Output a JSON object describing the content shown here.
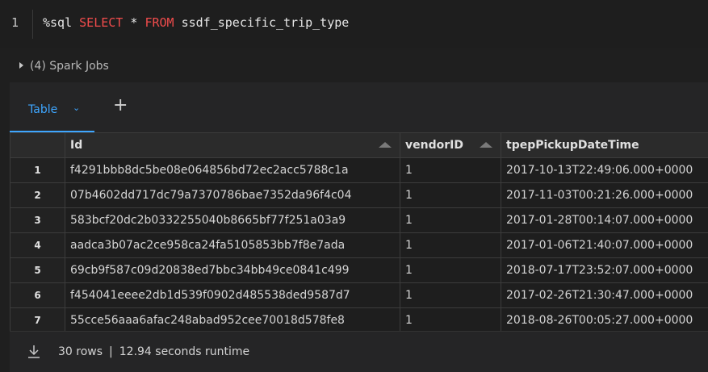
{
  "code": {
    "line_number": "1",
    "magic": "%sql",
    "keyword_select": "SELECT",
    "star": "*",
    "keyword_from": "FROM",
    "table_name": "ssdf_specific_trip_type"
  },
  "spark_jobs": {
    "label": "(4) Spark Jobs"
  },
  "tabs": {
    "active_label": "Table",
    "add_label": "+"
  },
  "table": {
    "columns": [
      "Id",
      "vendorID",
      "tpepPickupDateTime"
    ],
    "rows": [
      {
        "n": "1",
        "id": "f4291bbb8dc5be08e064856bd72ec2acc5788c1a",
        "vendor": "1",
        "pickup": "2017-10-13T22:49:06.000+0000"
      },
      {
        "n": "2",
        "id": "07b4602dd717dc79a7370786bae7352da96f4c04",
        "vendor": "1",
        "pickup": "2017-11-03T00:21:26.000+0000"
      },
      {
        "n": "3",
        "id": "583bcf20dc2b0332255040b8665bf77f251a03a9",
        "vendor": "1",
        "pickup": "2017-01-28T00:14:07.000+0000"
      },
      {
        "n": "4",
        "id": "aadca3b07ac2ce958ca24fa5105853bb7f8e7ada",
        "vendor": "1",
        "pickup": "2017-01-06T21:40:07.000+0000"
      },
      {
        "n": "5",
        "id": "69cb9f587c09d20838ed7bbc34bb49ce0841c499",
        "vendor": "1",
        "pickup": "2018-07-17T23:52:07.000+0000"
      },
      {
        "n": "6",
        "id": "f454041eeee2db1d539f0902d485538ded9587d7",
        "vendor": "1",
        "pickup": "2017-02-26T21:30:47.000+0000"
      },
      {
        "n": "7",
        "id": "55cce56aaa6afac248abad952cee70018d578fe8",
        "vendor": "1",
        "pickup": "2018-08-26T00:05:27.000+0000"
      }
    ]
  },
  "footer": {
    "rows": "30 rows",
    "separator": "|",
    "runtime": "12.94 seconds runtime"
  },
  "icons": {
    "download": "download-icon",
    "sort": "sort-arrow-icon",
    "expand": "chevron-down-icon"
  },
  "colors": {
    "accent": "#3ea6ff",
    "keyword": "#f14c4c",
    "background": "#1f1f1f"
  }
}
